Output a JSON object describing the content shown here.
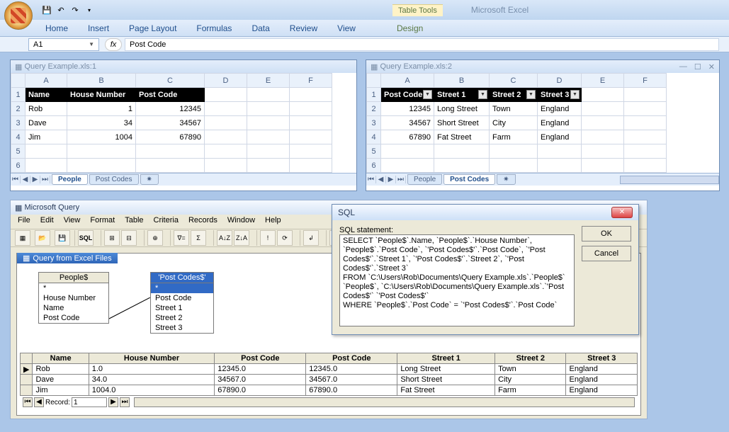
{
  "titlebar": {
    "table_tools": "Table Tools",
    "app_name": "Microsoft Excel"
  },
  "ribbon": {
    "tabs": [
      "Home",
      "Insert",
      "Page Layout",
      "Formulas",
      "Data",
      "Review",
      "View"
    ],
    "context_tab": "Design"
  },
  "name_box": "A1",
  "formula_value": "Post Code",
  "workbook1": {
    "title": "Query Example.xls:1",
    "cols": [
      "A",
      "B",
      "C",
      "D",
      "E",
      "F"
    ],
    "headers": [
      "Name",
      "House Number",
      "Post Code"
    ],
    "rows": [
      [
        "Rob",
        "1",
        "12345"
      ],
      [
        "Dave",
        "34",
        "34567"
      ],
      [
        "Jim",
        "1004",
        "67890"
      ]
    ],
    "tabs": [
      "People",
      "Post Codes"
    ],
    "active_tab": 0
  },
  "workbook2": {
    "title": "Query Example.xls:2",
    "cols": [
      "A",
      "B",
      "C",
      "D",
      "E",
      "F"
    ],
    "headers": [
      "Post Code",
      "Street 1",
      "Street 2",
      "Street 3"
    ],
    "rows": [
      [
        "12345",
        "Long Street",
        "Town",
        "England"
      ],
      [
        "34567",
        "Short Street",
        "City",
        "England"
      ],
      [
        "67890",
        "Fat Street",
        "Farm",
        "England"
      ]
    ],
    "tabs": [
      "People",
      "Post Codes"
    ],
    "active_tab": 1
  },
  "msquery": {
    "title": "Microsoft Query",
    "menu": [
      "File",
      "Edit",
      "View",
      "Format",
      "Table",
      "Criteria",
      "Records",
      "Window",
      "Help"
    ],
    "panel_title": "Query from Excel Files",
    "table1": {
      "name": "People$",
      "fields": [
        "*",
        "House Number",
        "Name",
        "Post Code"
      ]
    },
    "table2": {
      "name": "'Post Codes$'",
      "fields": [
        "*",
        "Post Code",
        "Street 1",
        "Street 2",
        "Street 3"
      ]
    },
    "result_headers": [
      "Name",
      "House Number",
      "Post Code",
      "Post Code",
      "Street 1",
      "Street 2",
      "Street 3"
    ],
    "result_rows": [
      [
        "Rob",
        "1.0",
        "12345.0",
        "12345.0",
        "Long Street",
        "Town",
        "England"
      ],
      [
        "Dave",
        "34.0",
        "34567.0",
        "34567.0",
        "Short Street",
        "City",
        "England"
      ],
      [
        "Jim",
        "1004.0",
        "67890.0",
        "67890.0",
        "Fat Street",
        "Farm",
        "England"
      ]
    ],
    "record_label": "Record:",
    "record_value": "1"
  },
  "sql_dialog": {
    "title": "SQL",
    "label": "SQL statement:",
    "statement": "SELECT `People$`.Name, `People$`.`House Number`, `People$`.`Post Code`, `'Post Codes$'`.`Post Code`, `'Post Codes$'`.`Street 1`, `'Post Codes$'`.`Street 2`, `'Post Codes$'`.`Street 3`\nFROM `C:\\Users\\Rob\\Documents\\Query Example.xls`.`People$` `People$`, `C:\\Users\\Rob\\Documents\\Query Example.xls`.`'Post Codes$'` `'Post Codes$'`\nWHERE `People$`.`Post Code` = `'Post Codes$'`.`Post Code`",
    "ok": "OK",
    "cancel": "Cancel"
  }
}
